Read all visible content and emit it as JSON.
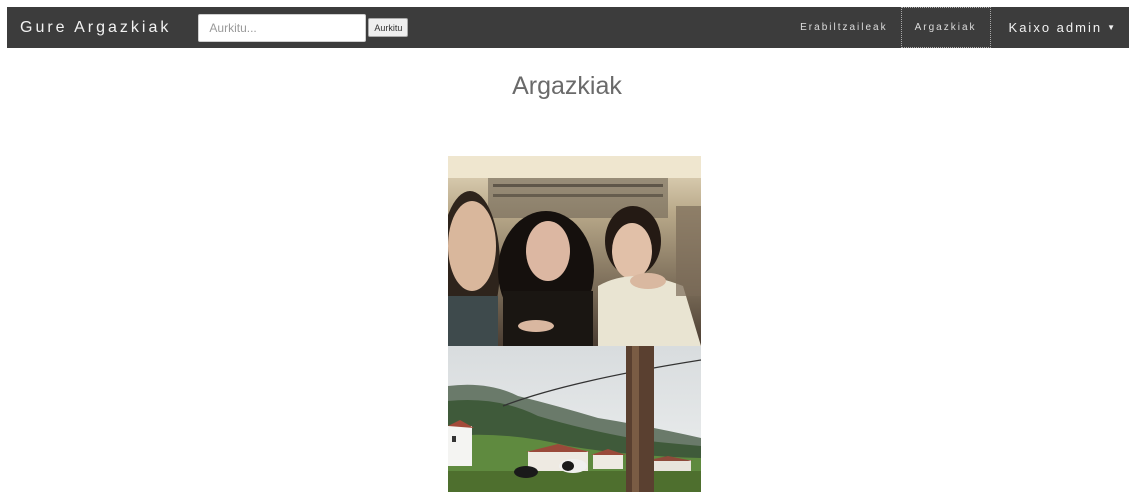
{
  "app": {
    "brand": "Gure Argazkiak"
  },
  "search": {
    "placeholder": "Aurkitu...",
    "value": "",
    "button_label": "Aurkitu"
  },
  "nav": {
    "items": [
      {
        "label": "Erabiltzaileak",
        "active": false
      },
      {
        "label": "Argazkiak",
        "active": true
      }
    ],
    "user_label": "Kaixo admin"
  },
  "page": {
    "title": "Argazkiak"
  },
  "colors": {
    "navbar_bg": "#3c3c3c",
    "title": "#6a6a6a"
  }
}
